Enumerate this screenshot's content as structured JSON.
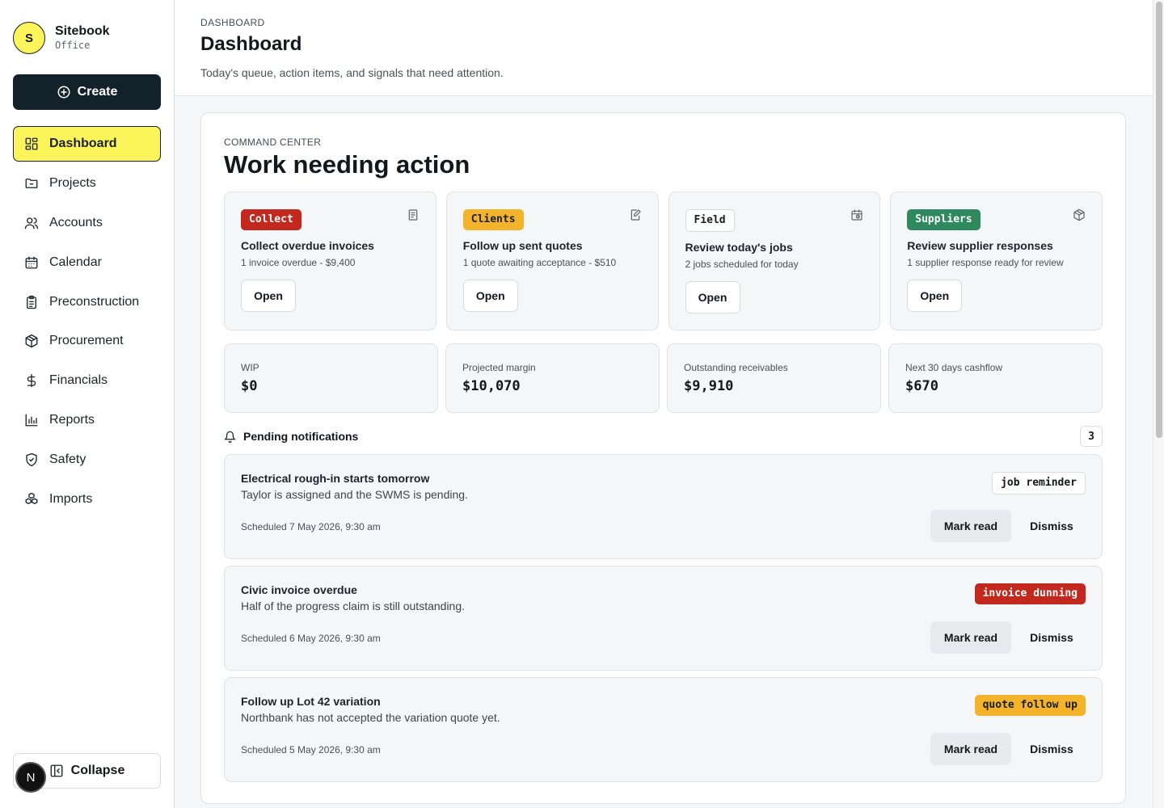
{
  "brand": {
    "initial": "S",
    "name": "Sitebook",
    "subtitle": "Office"
  },
  "create_label": "Create",
  "nav": [
    {
      "label": "Dashboard",
      "icon": "dashboard-icon",
      "active": true
    },
    {
      "label": "Projects",
      "icon": "folder-icon"
    },
    {
      "label": "Accounts",
      "icon": "users-icon"
    },
    {
      "label": "Calendar",
      "icon": "calendar-icon"
    },
    {
      "label": "Preconstruction",
      "icon": "clipboard-icon"
    },
    {
      "label": "Procurement",
      "icon": "package-icon"
    },
    {
      "label": "Financials",
      "icon": "dollar-icon"
    },
    {
      "label": "Reports",
      "icon": "bar-chart-icon"
    },
    {
      "label": "Safety",
      "icon": "shield-icon"
    },
    {
      "label": "Imports",
      "icon": "boxes-icon"
    }
  ],
  "collapse_label": "Collapse",
  "dev_badge": "N",
  "header": {
    "eyebrow": "DASHBOARD",
    "title": "Dashboard",
    "subtitle": "Today's queue, action items, and signals that need attention."
  },
  "command_center": {
    "eyebrow": "COMMAND CENTER",
    "title": "Work needing action",
    "actions": [
      {
        "tag": "Collect",
        "title": "Collect overdue invoices",
        "desc": "1 invoice overdue - $9,400",
        "button": "Open",
        "icon": "file-text-icon",
        "tag_color": "#c3281f"
      },
      {
        "tag": "Clients",
        "title": "Follow up sent quotes",
        "desc": "1 quote awaiting acceptance - $510",
        "button": "Open",
        "icon": "file-edit-icon",
        "tag_color": "#f3b42c"
      },
      {
        "tag": "Field",
        "title": "Review today's jobs",
        "desc": "2 jobs scheduled for today",
        "button": "Open",
        "icon": "calendar-clock-icon",
        "tag_color": "#ffffff"
      },
      {
        "tag": "Suppliers",
        "title": "Review supplier responses",
        "desc": "1 supplier response ready for review",
        "button": "Open",
        "icon": "package-icon",
        "tag_color": "#2e8a5e"
      }
    ],
    "metrics": [
      {
        "label": "WIP",
        "value": "$0"
      },
      {
        "label": "Projected margin",
        "value": "$10,070"
      },
      {
        "label": "Outstanding receivables",
        "value": "$9,910"
      },
      {
        "label": "Next 30 days cashflow",
        "value": "$670"
      }
    ]
  },
  "notifications": {
    "title": "Pending notifications",
    "count": "3",
    "items": [
      {
        "title": "Electrical rough-in starts tomorrow",
        "body": "Taylor is assigned and the SWMS is pending.",
        "time": "Scheduled 7 May 2026, 9:30 am",
        "tag": "job reminder",
        "mark_read": "Mark read",
        "dismiss": "Dismiss"
      },
      {
        "title": "Civic invoice overdue",
        "body": "Half of the progress claim is still outstanding.",
        "time": "Scheduled 6 May 2026, 9:30 am",
        "tag": "invoice dunning",
        "mark_read": "Mark read",
        "dismiss": "Dismiss"
      },
      {
        "title": "Follow up Lot 42 variation",
        "body": "Northbank has not accepted the variation quote yet.",
        "time": "Scheduled 5 May 2026, 9:30 am",
        "tag": "quote follow up",
        "mark_read": "Mark read",
        "dismiss": "Dismiss"
      }
    ]
  },
  "colors": {
    "accent": "#fbf45a",
    "primary_dark": "#13222a",
    "danger": "#c3281f",
    "warning": "#f3b42c",
    "success": "#2e8a5e"
  }
}
